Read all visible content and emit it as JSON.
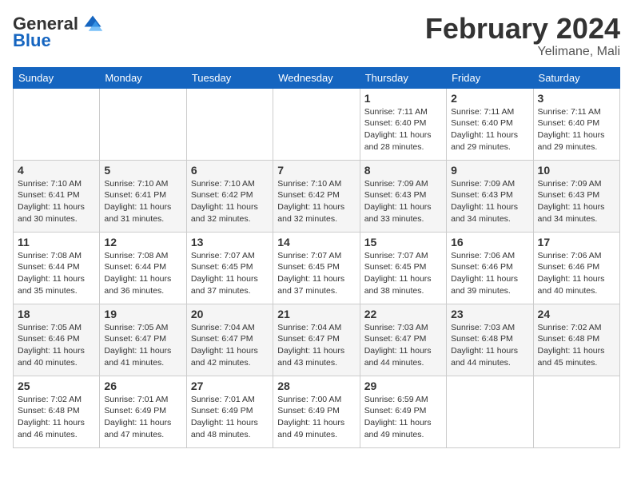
{
  "header": {
    "logo": {
      "general": "General",
      "blue": "Blue"
    },
    "title": "February 2024",
    "subtitle": "Yelimane, Mali"
  },
  "weekdays": [
    "Sunday",
    "Monday",
    "Tuesday",
    "Wednesday",
    "Thursday",
    "Friday",
    "Saturday"
  ],
  "weeks": [
    [
      {
        "day": "",
        "info": ""
      },
      {
        "day": "",
        "info": ""
      },
      {
        "day": "",
        "info": ""
      },
      {
        "day": "",
        "info": ""
      },
      {
        "day": "1",
        "info": "Sunrise: 7:11 AM\nSunset: 6:40 PM\nDaylight: 11 hours\nand 28 minutes."
      },
      {
        "day": "2",
        "info": "Sunrise: 7:11 AM\nSunset: 6:40 PM\nDaylight: 11 hours\nand 29 minutes."
      },
      {
        "day": "3",
        "info": "Sunrise: 7:11 AM\nSunset: 6:40 PM\nDaylight: 11 hours\nand 29 minutes."
      }
    ],
    [
      {
        "day": "4",
        "info": "Sunrise: 7:10 AM\nSunset: 6:41 PM\nDaylight: 11 hours\nand 30 minutes."
      },
      {
        "day": "5",
        "info": "Sunrise: 7:10 AM\nSunset: 6:41 PM\nDaylight: 11 hours\nand 31 minutes."
      },
      {
        "day": "6",
        "info": "Sunrise: 7:10 AM\nSunset: 6:42 PM\nDaylight: 11 hours\nand 32 minutes."
      },
      {
        "day": "7",
        "info": "Sunrise: 7:10 AM\nSunset: 6:42 PM\nDaylight: 11 hours\nand 32 minutes."
      },
      {
        "day": "8",
        "info": "Sunrise: 7:09 AM\nSunset: 6:43 PM\nDaylight: 11 hours\nand 33 minutes."
      },
      {
        "day": "9",
        "info": "Sunrise: 7:09 AM\nSunset: 6:43 PM\nDaylight: 11 hours\nand 34 minutes."
      },
      {
        "day": "10",
        "info": "Sunrise: 7:09 AM\nSunset: 6:43 PM\nDaylight: 11 hours\nand 34 minutes."
      }
    ],
    [
      {
        "day": "11",
        "info": "Sunrise: 7:08 AM\nSunset: 6:44 PM\nDaylight: 11 hours\nand 35 minutes."
      },
      {
        "day": "12",
        "info": "Sunrise: 7:08 AM\nSunset: 6:44 PM\nDaylight: 11 hours\nand 36 minutes."
      },
      {
        "day": "13",
        "info": "Sunrise: 7:07 AM\nSunset: 6:45 PM\nDaylight: 11 hours\nand 37 minutes."
      },
      {
        "day": "14",
        "info": "Sunrise: 7:07 AM\nSunset: 6:45 PM\nDaylight: 11 hours\nand 37 minutes."
      },
      {
        "day": "15",
        "info": "Sunrise: 7:07 AM\nSunset: 6:45 PM\nDaylight: 11 hours\nand 38 minutes."
      },
      {
        "day": "16",
        "info": "Sunrise: 7:06 AM\nSunset: 6:46 PM\nDaylight: 11 hours\nand 39 minutes."
      },
      {
        "day": "17",
        "info": "Sunrise: 7:06 AM\nSunset: 6:46 PM\nDaylight: 11 hours\nand 40 minutes."
      }
    ],
    [
      {
        "day": "18",
        "info": "Sunrise: 7:05 AM\nSunset: 6:46 PM\nDaylight: 11 hours\nand 40 minutes."
      },
      {
        "day": "19",
        "info": "Sunrise: 7:05 AM\nSunset: 6:47 PM\nDaylight: 11 hours\nand 41 minutes."
      },
      {
        "day": "20",
        "info": "Sunrise: 7:04 AM\nSunset: 6:47 PM\nDaylight: 11 hours\nand 42 minutes."
      },
      {
        "day": "21",
        "info": "Sunrise: 7:04 AM\nSunset: 6:47 PM\nDaylight: 11 hours\nand 43 minutes."
      },
      {
        "day": "22",
        "info": "Sunrise: 7:03 AM\nSunset: 6:47 PM\nDaylight: 11 hours\nand 44 minutes."
      },
      {
        "day": "23",
        "info": "Sunrise: 7:03 AM\nSunset: 6:48 PM\nDaylight: 11 hours\nand 44 minutes."
      },
      {
        "day": "24",
        "info": "Sunrise: 7:02 AM\nSunset: 6:48 PM\nDaylight: 11 hours\nand 45 minutes."
      }
    ],
    [
      {
        "day": "25",
        "info": "Sunrise: 7:02 AM\nSunset: 6:48 PM\nDaylight: 11 hours\nand 46 minutes."
      },
      {
        "day": "26",
        "info": "Sunrise: 7:01 AM\nSunset: 6:49 PM\nDaylight: 11 hours\nand 47 minutes."
      },
      {
        "day": "27",
        "info": "Sunrise: 7:01 AM\nSunset: 6:49 PM\nDaylight: 11 hours\nand 48 minutes."
      },
      {
        "day": "28",
        "info": "Sunrise: 7:00 AM\nSunset: 6:49 PM\nDaylight: 11 hours\nand 49 minutes."
      },
      {
        "day": "29",
        "info": "Sunrise: 6:59 AM\nSunset: 6:49 PM\nDaylight: 11 hours\nand 49 minutes."
      },
      {
        "day": "",
        "info": ""
      },
      {
        "day": "",
        "info": ""
      }
    ]
  ]
}
